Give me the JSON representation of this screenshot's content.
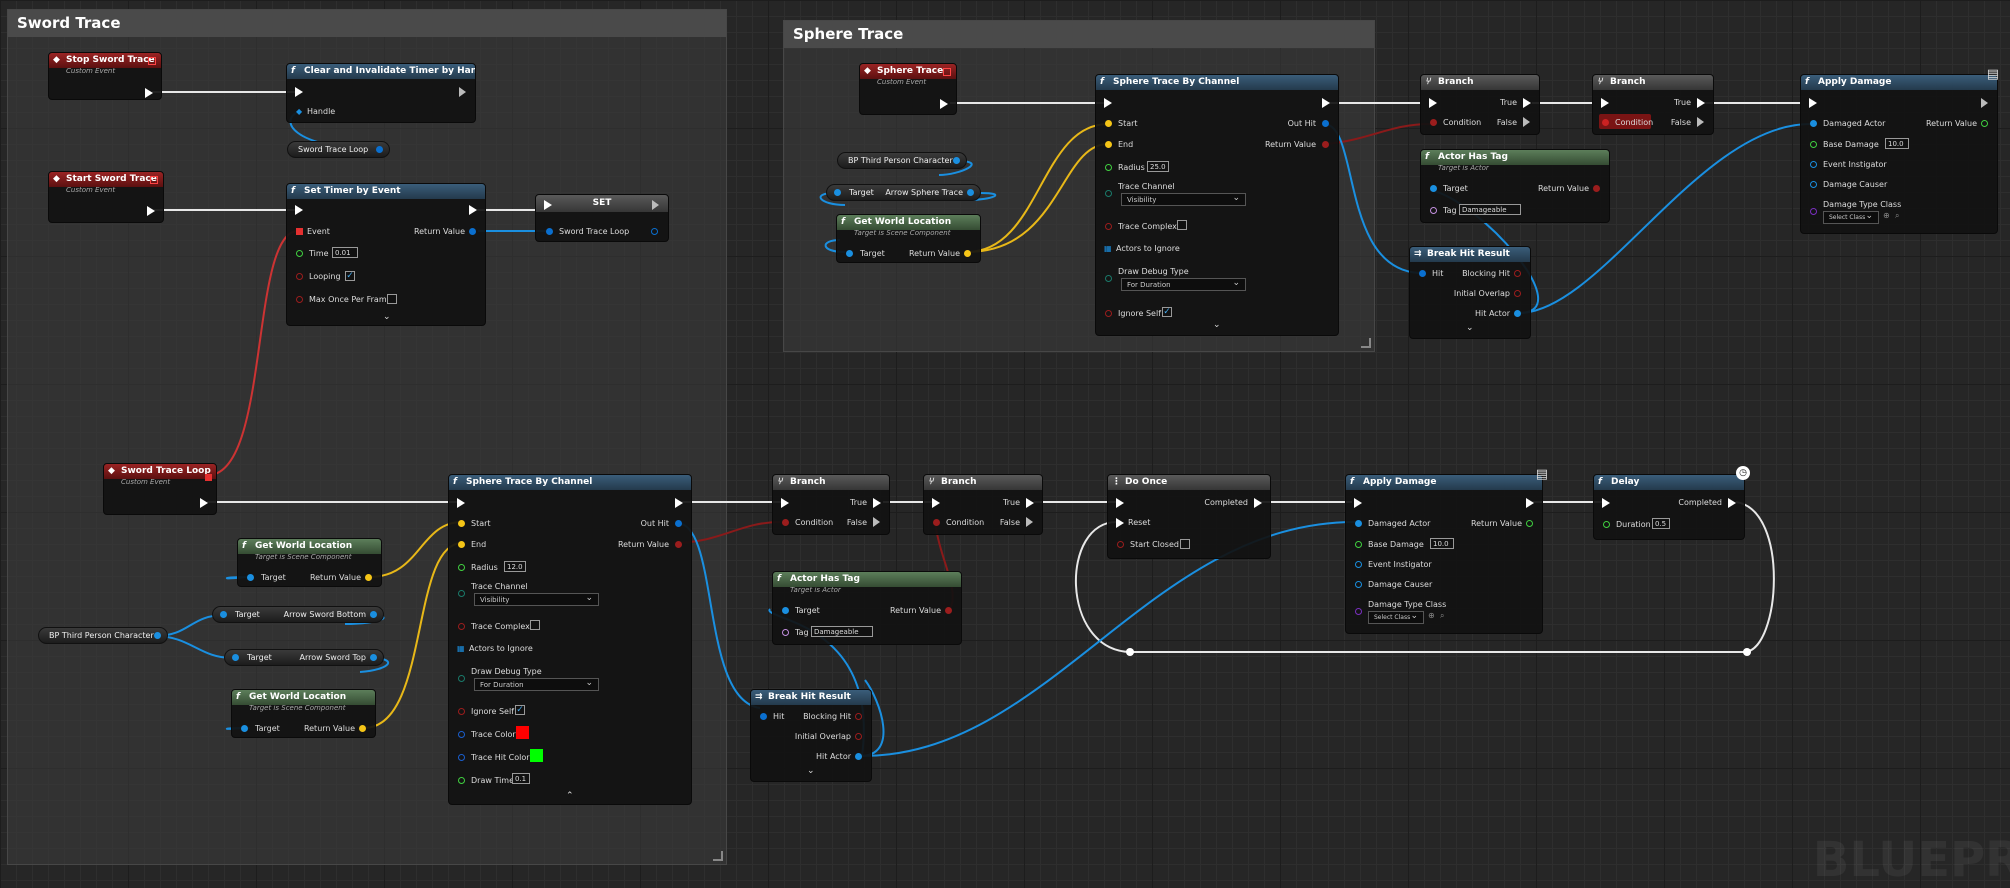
{
  "comments": {
    "sword_trace": "Sword Trace",
    "sphere_trace": "Sphere Trace"
  },
  "common": {
    "custom_event": "Custom Event",
    "target_is_scene_component": "Target is Scene Component",
    "target_is_actor": "Target is Actor",
    "true": "True",
    "false": "False",
    "condition": "Condition",
    "target": "Target",
    "return_value": "Return Value",
    "start": "Start",
    "end": "End",
    "radius": "Radius",
    "trace_channel": "Trace Channel",
    "trace_complex": "Trace Complex",
    "actors_to_ignore": "Actors to Ignore",
    "draw_debug_type": "Draw Debug Type",
    "ignore_self": "Ignore Self",
    "out_hit": "Out Hit",
    "hit": "Hit",
    "blocking_hit": "Blocking Hit",
    "initial_overlap": "Initial Overlap",
    "hit_actor": "Hit Actor",
    "tag": "Tag",
    "damageable": "Damageable",
    "visibility": "Visibility",
    "for_duration": "For Duration",
    "damaged_actor": "Damaged Actor",
    "base_damage": "Base Damage",
    "event_instigator": "Event Instigator",
    "damage_causer": "Damage Causer",
    "damage_type_class": "Damage Type Class",
    "select_class": "Select Class"
  },
  "nodes": {
    "stop_sword_trace": "Stop Sword Trace",
    "clear_timer": "Clear and Invalidate Timer by Handle",
    "handle": "Handle",
    "sword_trace_loop_var": "Sword Trace Loop",
    "start_sword_trace": "Start Sword Trace",
    "set_timer": "Set Timer by Event",
    "event": "Event",
    "time": "Time",
    "time_value": "0.01",
    "looping": "Looping",
    "max_once": "Max Once Per Frame",
    "set": "SET",
    "set_var": "Sword Trace Loop",
    "sword_trace_loop_event": "Sword Trace Loop",
    "gwl": "Get World Location",
    "bp_third_person": "BP Third Person Character",
    "arrow_sword_bottom": "Arrow Sword Bottom",
    "arrow_sword_top": "Arrow Sword Top",
    "arrow_sphere_trace": "Arrow Sphere Trace",
    "sphere_trace_by_channel": "Sphere Trace By Channel",
    "radius_bottom": "12.0",
    "radius_top": "25.0",
    "trace_color": "Trace Color",
    "trace_hit_color": "Trace Hit Color",
    "draw_time": "Draw Time",
    "draw_time_value": "0.1",
    "branch": "Branch",
    "actor_has_tag": "Actor Has Tag",
    "break_hit_result": "Break Hit Result",
    "do_once": "Do Once",
    "completed": "Completed",
    "reset": "Reset",
    "start_closed": "Start Closed",
    "apply_damage": "Apply Damage",
    "base_damage_value": "10.0",
    "delay": "Delay",
    "duration": "Duration",
    "duration_value": "0.5",
    "sphere_trace_event": "Sphere Trace"
  },
  "colors": {
    "exec": "#ffffff",
    "object": "#1a8fe0",
    "vector": "#f5c517",
    "bool": "#9b1d1d",
    "float": "#40d040",
    "struct": "#0a6fcf",
    "name": "#c490e0",
    "event_red": "#e53030",
    "trace_color": "#ff0000",
    "trace_hit_color": "#00ff00"
  },
  "watermark": "BLUEPRI"
}
